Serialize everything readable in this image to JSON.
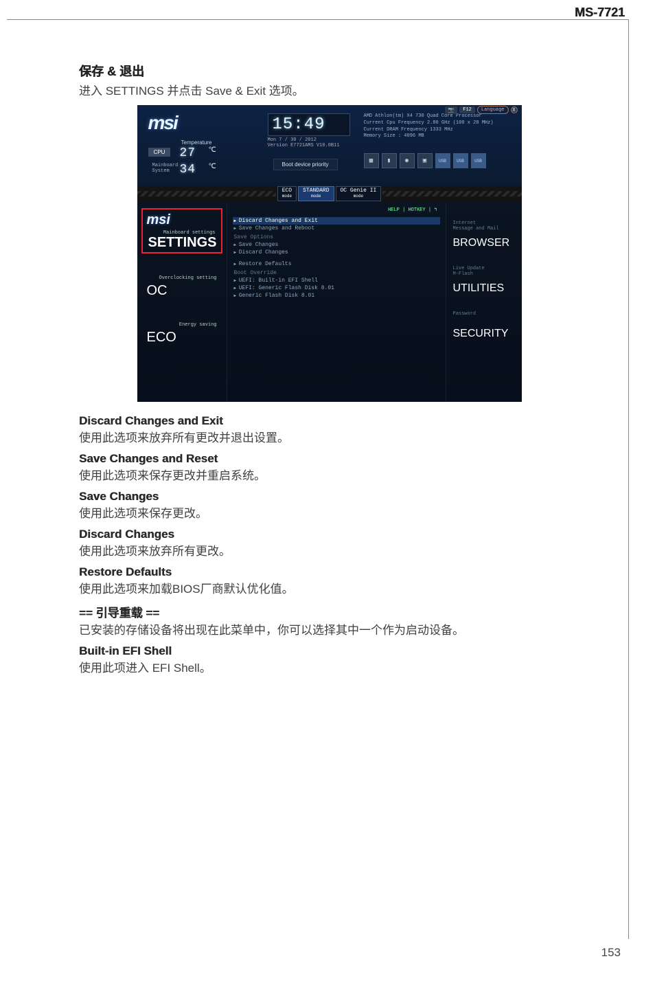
{
  "header": {
    "model": "MS-7721"
  },
  "page_number": "153",
  "intro": {
    "title": "保存 & 退出",
    "subtitle": "进入 SETTINGS 并点击 Save & Exit 选项。"
  },
  "bios": {
    "logo": "msi",
    "temp_label": "Temperature",
    "cpu_badge": "CPU",
    "cpu_temp": "27",
    "cpu_unit": "℃",
    "mb_label": "Mainboard\nSystem",
    "sys_temp": "34",
    "sys_unit": "℃",
    "clock": "15:49",
    "date": "Mon  7 / 30 / 2012",
    "version": "Version E7721AMS V10.0B11",
    "sysinfo": "AMD Athlon(tm) X4 730 Quad Core Processor\nCurrent Cpu Frequency 2.80 GHz (100 x 28 MHz)\nCurrent DRAM Frequency 1333 MHz\nMemory Size : 4096 MB",
    "boot_priority": "Boot device priority",
    "usb_label": "USB",
    "top_f12": "F12",
    "top_lang": "Language",
    "top_x": "X",
    "modes": {
      "eco": "ECO",
      "std": "STANDARD",
      "ocg": "OC Genie II",
      "sub": "mode"
    },
    "left": {
      "settings_sub": "Mainboard settings",
      "settings_main": "SETTINGS",
      "oc_sub": "Overclocking setting",
      "oc_main": "OC",
      "eco_sub": "Energy saving",
      "eco_main": "ECO"
    },
    "center": {
      "help": "HELP | HOTKEY | ↰",
      "i1": "Discard Changes and Exit",
      "i2": "Save Changes and Reboot",
      "g1": "Save Options",
      "i3": "Save Changes",
      "i4": "Discard Changes",
      "i5": "Restore Defaults",
      "g2": "Boot Override",
      "i6": "UEFI: Built-in EFI Shell",
      "i7": "UEFI: Generic Flash Disk 8.01",
      "i8": "Generic Flash Disk 8.01"
    },
    "right": {
      "browser_sub": "Internet\nMessage and Mail",
      "browser_main": "BROWSER",
      "util_sub": "Live Update\nM-Flash",
      "util_main": "UTILITIES",
      "sec_sub": "Password",
      "sec_main": "SECURITY"
    }
  },
  "descriptions": [
    {
      "title": "Discard Changes and Exit",
      "text": "使用此选项来放弃所有更改并退出设置。"
    },
    {
      "title": "Save Changes and Reset",
      "text": "使用此选项来保存更改并重启系统。"
    },
    {
      "title": "Save Changes",
      "text": "使用此选项来保存更改。"
    },
    {
      "title": "Discard Changes",
      "text": "使用此选项来放弃所有更改。"
    },
    {
      "title": "Restore Defaults",
      "text": "使用此选项来加载BIOS厂商默认优化值。"
    },
    {
      "title": "== 引导重载 ==",
      "text": "已安装的存储设备将出现在此菜单中，你可以选择其中一个作为启动设备。"
    },
    {
      "title": "Built-in EFI Shell",
      "text": "使用此项进入 EFI Shell。"
    }
  ]
}
